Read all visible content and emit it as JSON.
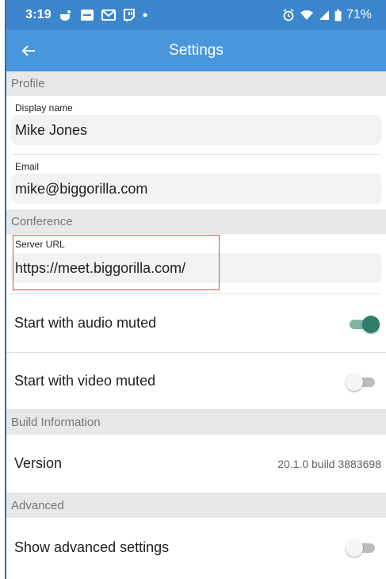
{
  "status_bar": {
    "time": "3:19",
    "battery": "71%",
    "icons_left": [
      "notification-app-icon",
      "notification-app2-icon",
      "gmail-icon",
      "twitch-icon",
      "dot-icon"
    ],
    "icons_right": [
      "alarm-icon",
      "wifi-icon",
      "signal-icon",
      "battery-icon"
    ]
  },
  "app_bar": {
    "title": "Settings",
    "back_icon": "arrow-back-icon"
  },
  "profile": {
    "header": "Profile",
    "display_name_label": "Display name",
    "display_name_value": "Mike Jones",
    "email_label": "Email",
    "email_value": "mike@biggorilla.com"
  },
  "conference": {
    "header": "Conference",
    "server_url_label": "Server URL",
    "server_url_value": "https://meet.biggorilla.com/",
    "audio_muted_label": "Start with audio muted",
    "audio_muted": true,
    "video_muted_label": "Start with video muted",
    "video_muted": false
  },
  "build": {
    "header": "Build Information",
    "version_label": "Version",
    "version_value": "20.1.0 build 3883698"
  },
  "advanced": {
    "header": "Advanced",
    "show_advanced_label": "Show advanced settings",
    "show_advanced": false
  },
  "colors": {
    "status_bar": "#3b86cd",
    "app_bar": "#4a96dd",
    "toggle_on": "#2e7d6b",
    "highlight": "#e0513a"
  }
}
